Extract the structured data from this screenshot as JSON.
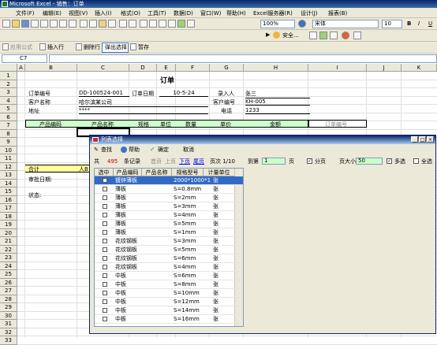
{
  "window": {
    "title": "Microsoft Excel - 销售：订单"
  },
  "menu": [
    "文件(F)",
    "编辑(E)",
    "视图(V)",
    "插入(I)",
    "格式(O)",
    "工具(T)",
    "数据(D)",
    "窗口(W)",
    "帮助(H)",
    "Excel服务器(R)",
    "设计(J)",
    "报表(B)"
  ],
  "toolbar": {
    "zoom": "100%",
    "font": "宋体",
    "fontsize": "10",
    "security": "安全...",
    "buttons2": {
      "apply_formula": "应用公式",
      "insert_row": "插入行",
      "delete_row": "删除行",
      "pop_select": "弹出选择",
      "save_draft": "暂存"
    }
  },
  "namebox": "C7",
  "columns": [
    "A",
    "B",
    "C",
    "D",
    "E",
    "F",
    "G",
    "H",
    "I",
    "J",
    "K"
  ],
  "rows": [
    "1",
    "2",
    "3",
    "4",
    "5",
    "6",
    "7",
    "8",
    "9",
    "10",
    "11",
    "12",
    "13",
    "14",
    "15",
    "16",
    "17",
    "18",
    "19",
    "20",
    "21",
    "22",
    "23",
    "24",
    "25",
    "26",
    "27",
    "28",
    "29",
    "30",
    "31",
    "32",
    "33",
    "34",
    "35"
  ],
  "sheet": {
    "title": "订单",
    "order_no_label": "订单编号",
    "order_no": "DD-100524-001",
    "order_date_label": "订单日期",
    "order_date": "10-5-24",
    "entry_label": "录入人",
    "entry": "张三",
    "customer_label": "客户名称",
    "customer": "哈尔滨某公司",
    "cust_no_label": "客户编号",
    "cust_no": "KH-005",
    "addr_label": "地址",
    "addr": "****",
    "phone_label": "电话",
    "phone": "1233",
    "hdr_product_code": "产品编码",
    "hdr_product_name": "产品名称",
    "hdr_spec": "规格",
    "hdr_unit": "单位",
    "hdr_qty": "数量",
    "hdr_price": "单价",
    "hdr_amount": "金额",
    "hdr_order_no": "订单编号",
    "total_label": "合计",
    "total_partial": "人B",
    "approve_label": "审批日期:",
    "status_label": "状态:"
  },
  "dialog": {
    "title": "列表选择",
    "find": "查找",
    "help": "帮助",
    "ok": "确定",
    "cancel": "取消",
    "total_prefix": "共",
    "total_count": "495",
    "records": "条记录",
    "first": "首页",
    "prev": "上页",
    "next": "下页",
    "last": "尾页",
    "page_label": "页次 1/10",
    "goto_label": "到第",
    "goto_value": "1",
    "page_unit": "页",
    "paging": "分页",
    "page_size_label": "页大小",
    "page_size": "50",
    "multi": "多选",
    "select_all": "全选",
    "headers": [
      "选中",
      "产品编码",
      "产品名称",
      "规格型号",
      "计量单位"
    ],
    "rows": [
      {
        "name": "镀锌薄板",
        "spec": "2000*1000*1",
        "unit": "张"
      },
      {
        "name": "薄板",
        "spec": "S=0.8mm",
        "unit": "张"
      },
      {
        "name": "薄板",
        "spec": "S=2mm",
        "unit": "张"
      },
      {
        "name": "薄板",
        "spec": "S=3mm",
        "unit": "张"
      },
      {
        "name": "薄板",
        "spec": "S=4mm",
        "unit": "张"
      },
      {
        "name": "薄板",
        "spec": "S=5mm",
        "unit": "张"
      },
      {
        "name": "薄板",
        "spec": "S=1mm",
        "unit": "张"
      },
      {
        "name": "花纹钢板",
        "spec": "S=3mm",
        "unit": "张"
      },
      {
        "name": "花纹钢板",
        "spec": "S=5mm",
        "unit": "张"
      },
      {
        "name": "花纹钢板",
        "spec": "S=6mm",
        "unit": "张"
      },
      {
        "name": "花纹钢板",
        "spec": "S=4mm",
        "unit": "张"
      },
      {
        "name": "中板",
        "spec": "S=6mm",
        "unit": "张"
      },
      {
        "name": "中板",
        "spec": "S=8mm",
        "unit": "张"
      },
      {
        "name": "中板",
        "spec": "S=10mm",
        "unit": "张"
      },
      {
        "name": "中板",
        "spec": "S=12mm",
        "unit": "张"
      },
      {
        "name": "中板",
        "spec": "S=14mm",
        "unit": "张"
      },
      {
        "name": "中板",
        "spec": "S=16mm",
        "unit": "张"
      }
    ]
  }
}
